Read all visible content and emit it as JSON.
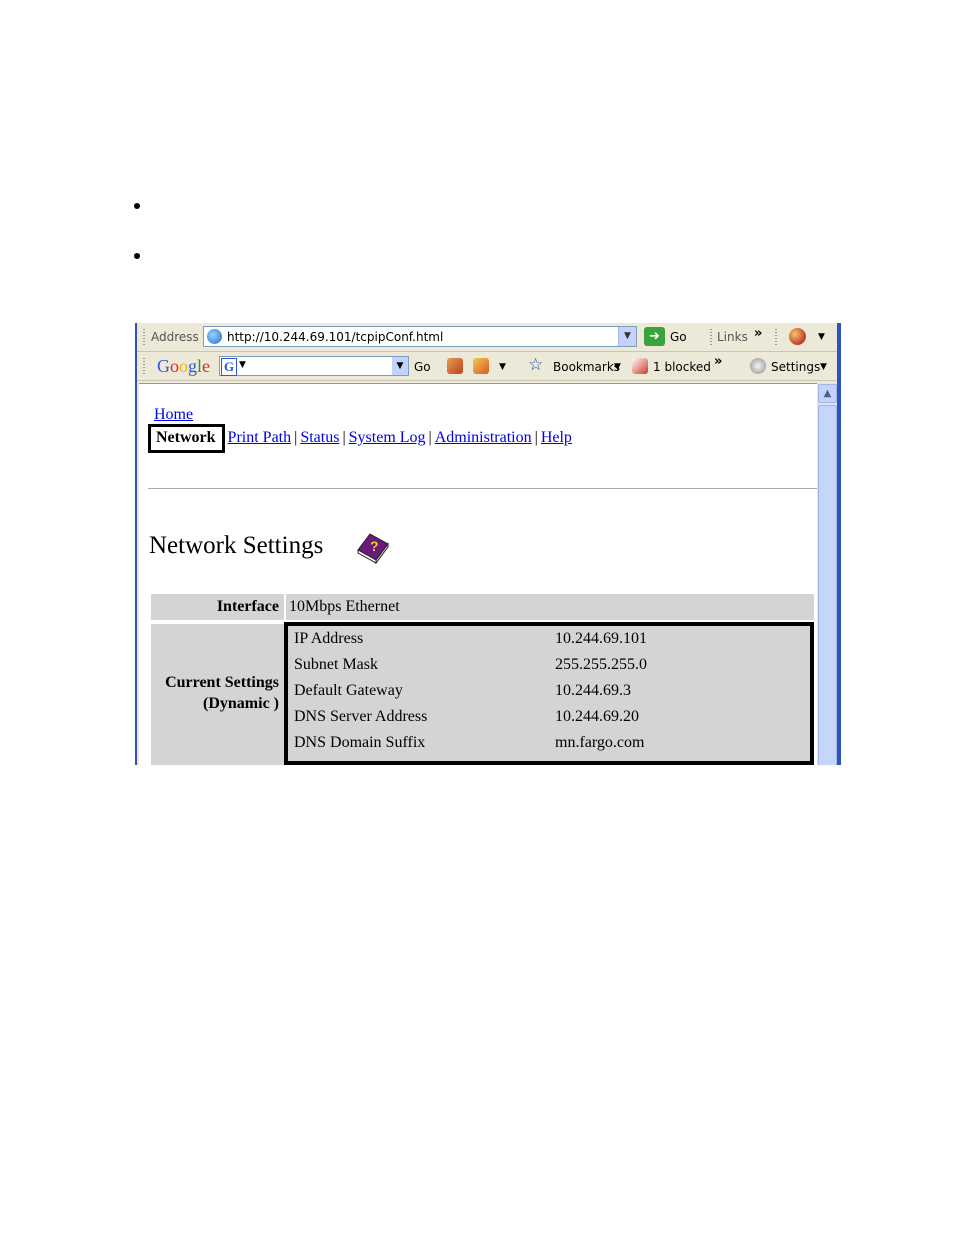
{
  "toolbar": {
    "address_label": "Address",
    "url": "http://10.244.69.101/tcpipConf.html",
    "go_label": "Go",
    "links_label": "Links",
    "more_chevron": "»"
  },
  "google_bar": {
    "logo": "Google",
    "go_label": "Go",
    "bookmarks_label": "Bookmarks",
    "blocked_label": "1 blocked",
    "settings_label": "Settings",
    "more_chevron": "»"
  },
  "nav": {
    "home": "Home",
    "active": "Network",
    "links": [
      "Print Path",
      "Status",
      "System Log",
      "Administration",
      "Help"
    ],
    "separator": "|"
  },
  "page": {
    "title": "Network Settings"
  },
  "settings_table": {
    "interface_label": "Interface",
    "interface_value": "10Mbps Ethernet",
    "current_label_line1": "Current Settings",
    "current_label_line2": "(Dynamic )",
    "rows": [
      {
        "key": "IP Address",
        "value": "10.244.69.101"
      },
      {
        "key": "Subnet Mask",
        "value": "255.255.255.0"
      },
      {
        "key": "Default Gateway",
        "value": "10.244.69.3"
      },
      {
        "key": "DNS Server Address",
        "value": "10.244.69.20"
      },
      {
        "key": "DNS Domain Suffix",
        "value": "mn.fargo.com"
      }
    ]
  }
}
